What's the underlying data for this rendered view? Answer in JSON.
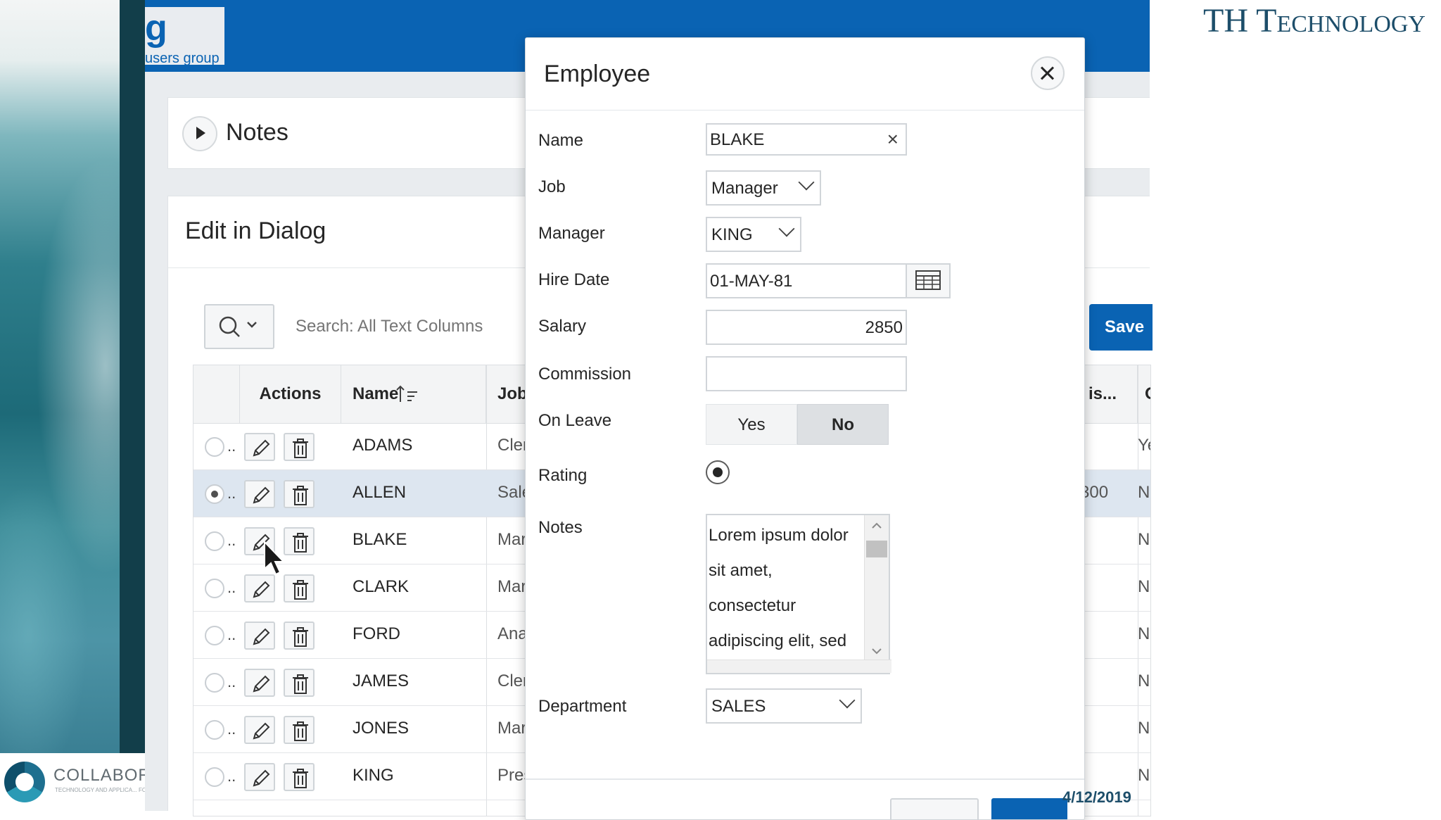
{
  "brand": {
    "org_letter": "g",
    "org_sub": "users group",
    "banner_text": "TH Technology",
    "date": "4/12/2019"
  },
  "collab_logo": {
    "name": "COLLABOR",
    "tagline": "TECHNOLOGY AND APPLICA... FOR THE ORACLE COMMUNIT..."
  },
  "regions": {
    "notes_title": "Notes",
    "edit_title": "Edit in Dialog"
  },
  "toolbar": {
    "search_placeholder": "Search: All Text Columns",
    "save_label": "Save"
  },
  "grid": {
    "columns": {
      "actions": "Actions",
      "name": "Name",
      "job": "Job",
      "comm": "is...",
      "onleave": "O"
    },
    "rows": [
      {
        "name": "ADAMS",
        "job": "Cler",
        "comm": "-",
        "leave": "Ye",
        "selected": false
      },
      {
        "name": "ALLEN",
        "job": "Sale",
        "comm": "300",
        "leave": "N",
        "selected": true
      },
      {
        "name": "BLAKE",
        "job": "Mar",
        "comm": "-",
        "leave": "N",
        "selected": false
      },
      {
        "name": "CLARK",
        "job": "Mar",
        "comm": "-",
        "leave": "N",
        "selected": false
      },
      {
        "name": "FORD",
        "job": "Ana",
        "comm": "-",
        "leave": "N",
        "selected": false
      },
      {
        "name": "JAMES",
        "job": "Cler",
        "comm": "-",
        "leave": "N",
        "selected": false
      },
      {
        "name": "JONES",
        "job": "Mar",
        "comm": "-",
        "leave": "N",
        "selected": false
      },
      {
        "name": "KING",
        "job": "Pres",
        "comm": "-",
        "leave": "N",
        "selected": false
      }
    ]
  },
  "dialog": {
    "title": "Employee",
    "labels": {
      "name": "Name",
      "job": "Job",
      "manager": "Manager",
      "hire_date": "Hire Date",
      "salary": "Salary",
      "commission": "Commission",
      "on_leave": "On Leave",
      "rating": "Rating",
      "notes": "Notes",
      "department": "Department"
    },
    "values": {
      "name": "BLAKE",
      "job": "Manager",
      "manager": "KING",
      "hire_date": "01-MAY-81",
      "salary": "2850",
      "commission": "",
      "leave_yes": "Yes",
      "leave_no": "No",
      "notes": "Lorem ipsum dolor sit amet, consectetur adipiscing elit, sed",
      "department": "SALES"
    }
  }
}
